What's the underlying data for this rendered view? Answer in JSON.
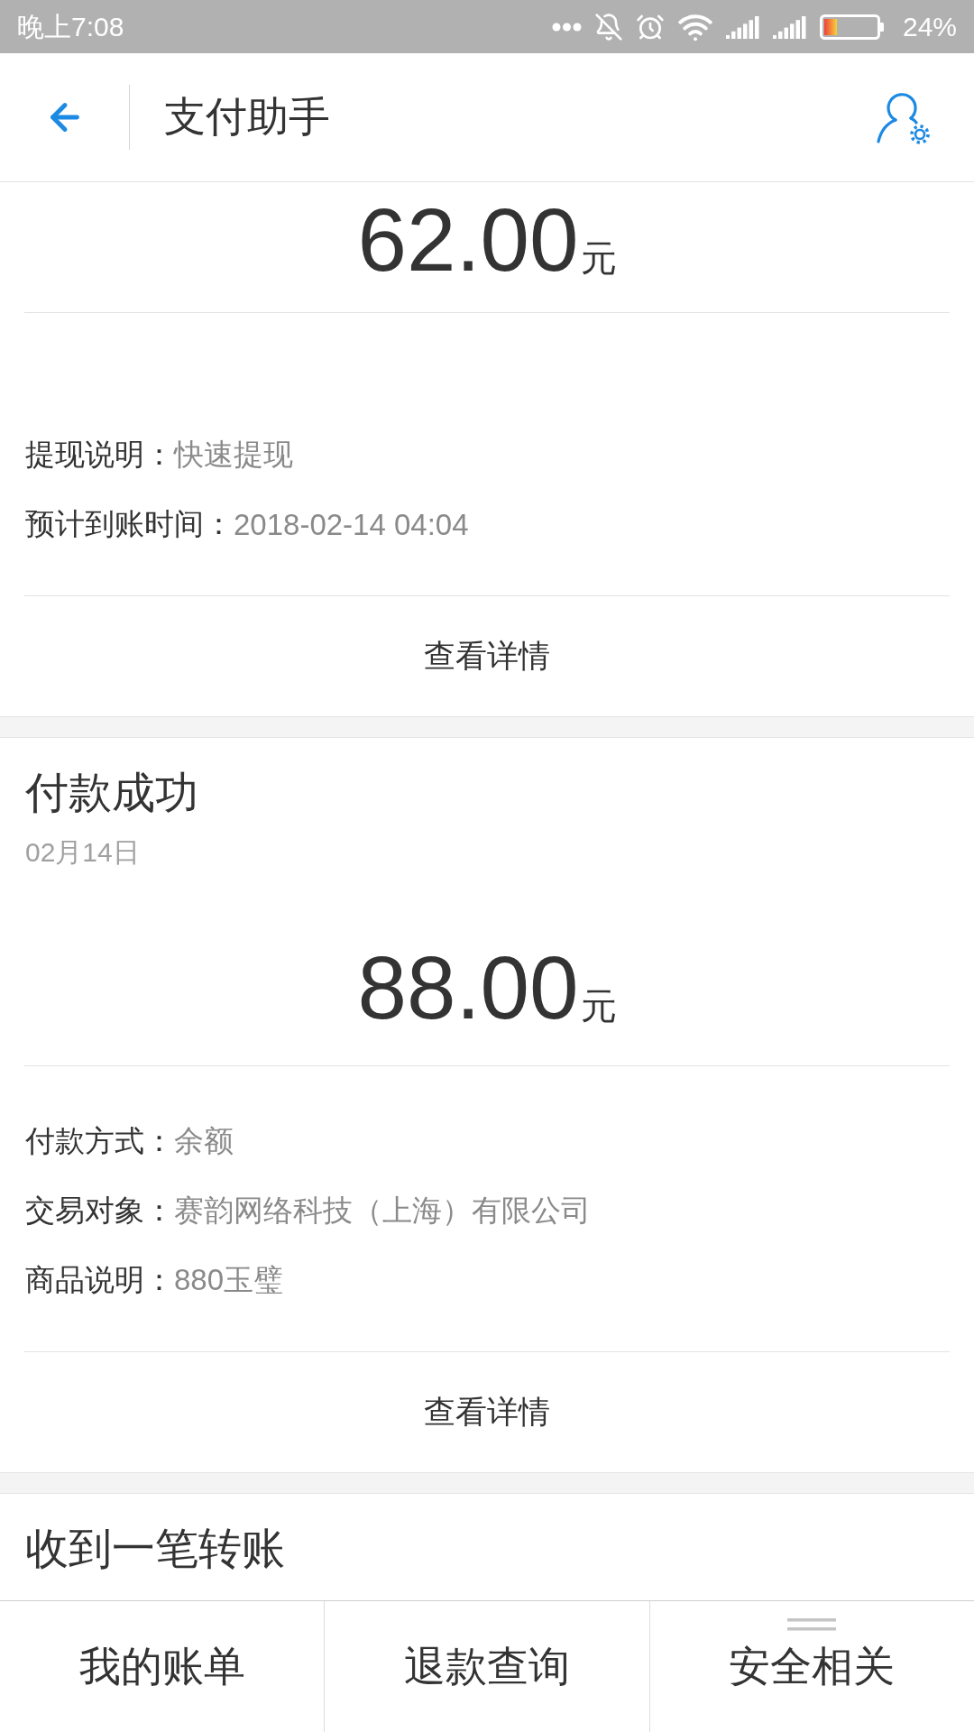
{
  "status_bar": {
    "time": "晚上7:08",
    "battery": "24%"
  },
  "header": {
    "title": "支付助手"
  },
  "cards": [
    {
      "amount": "62.00",
      "unit": "元",
      "details": [
        {
          "label": "提现说明：",
          "value": "快速提现"
        },
        {
          "label": "预计到账时间：",
          "value": "2018-02-14 04:04"
        }
      ],
      "action": "查看详情"
    },
    {
      "title": "付款成功",
      "date": "02月14日",
      "amount": "88.00",
      "unit": "元",
      "details": [
        {
          "label": "付款方式：",
          "value": "余额"
        },
        {
          "label": "交易对象：",
          "value": "赛韵网络科技（上海）有限公司"
        },
        {
          "label": "商品说明：",
          "value": "880玉璧"
        }
      ],
      "action": "查看详情"
    },
    {
      "title": "收到一笔转账"
    }
  ],
  "bottom_nav": [
    {
      "label": "我的账单",
      "has_submenu": false
    },
    {
      "label": "退款查询",
      "has_submenu": false
    },
    {
      "label": "安全相关",
      "has_submenu": true
    }
  ]
}
